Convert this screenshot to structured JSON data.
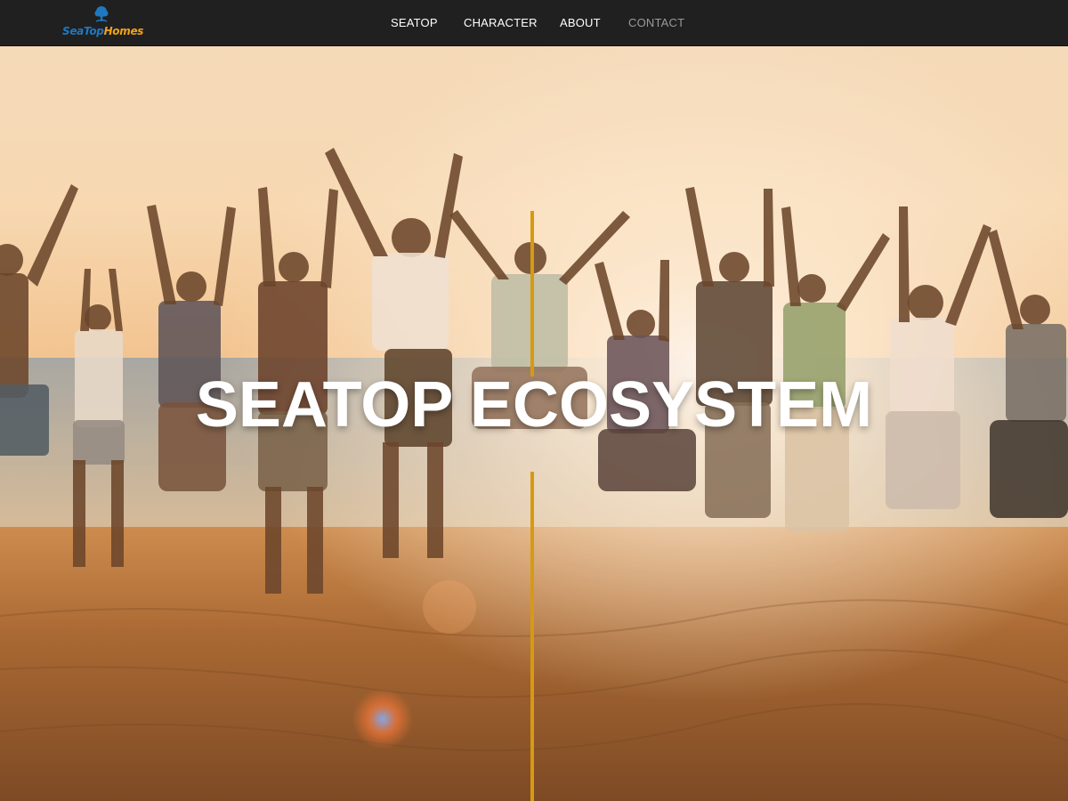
{
  "brand": {
    "logo_part1": "SeaTop",
    "logo_part2": "Homes",
    "logo_icon": "tree-icon"
  },
  "nav": {
    "items": [
      {
        "label": "SEATOP",
        "active": false
      },
      {
        "label": "CHARACTER",
        "active": false
      },
      {
        "label": "ABOUT",
        "active": false
      },
      {
        "label": "CONTACT",
        "active": true
      }
    ]
  },
  "hero": {
    "title": "SEATOP ECOSYSTEM",
    "image_icon": "beach-photo"
  },
  "colors": {
    "nav_bg": "#202020",
    "accent": "#d69a12",
    "logo_blue": "#1f78c0",
    "logo_orange": "#f0a21b"
  }
}
